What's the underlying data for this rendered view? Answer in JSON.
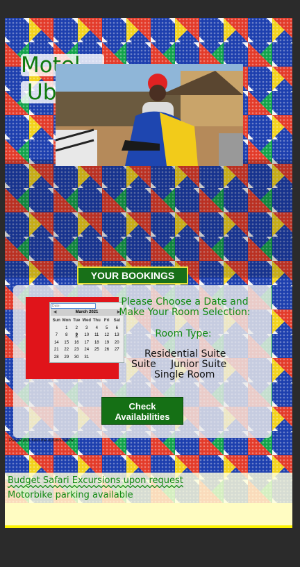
{
  "brand": {
    "line1": "Motel",
    "line2": "Ubuntu"
  },
  "bookings_heading": "YOUR BOOKINGS",
  "calendar": {
    "input_label": "Date:",
    "month_label": "March 2021",
    "prev_icon": "chevron-left-icon",
    "next_icon": "chevron-right-icon",
    "weekdays": [
      "Sun",
      "Mon",
      "Tue",
      "Wed",
      "Thu",
      "Fri",
      "Sat"
    ],
    "weeks": [
      [
        "",
        "1",
        "2",
        "3",
        "4",
        "5",
        "6"
      ],
      [
        "7",
        "8",
        "9",
        "10",
        "11",
        "12",
        "13"
      ],
      [
        "14",
        "15",
        "16",
        "17",
        "18",
        "19",
        "20"
      ],
      [
        "21",
        "22",
        "23",
        "24",
        "25",
        "26",
        "27"
      ],
      [
        "28",
        "29",
        "30",
        "31",
        "",
        "",
        ""
      ]
    ]
  },
  "prompt": {
    "line1": "Please Choose a Date and",
    "line2": "Make Your Room Selection:"
  },
  "room": {
    "type_label": "Room Type:",
    "options": [
      "Residential Suite",
      "Suite",
      "Junior Suite",
      "Single Room"
    ]
  },
  "check_button": {
    "line1": "Check",
    "line2": "Availabilities"
  },
  "note": "Please pick from the options below:",
  "footer": {
    "line1": "Budget Safari Excursions upon request",
    "line2": "Motorbike parking available"
  },
  "colors": {
    "brand_green": "#138a13",
    "banner_green": "#187018",
    "accent_yellow": "#fbf200",
    "calendar_red": "#e0141a"
  }
}
